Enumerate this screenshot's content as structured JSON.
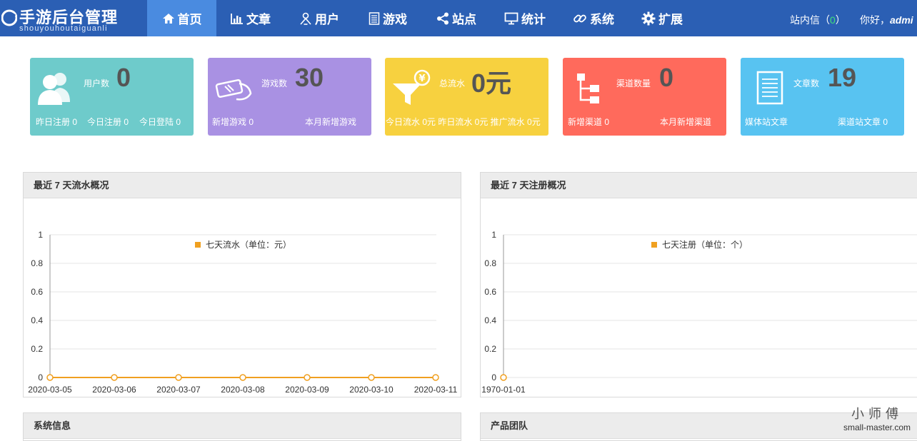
{
  "logo": {
    "title": "手游后台管理",
    "subtitle": "shouyouhoutaiguanli"
  },
  "nav": [
    {
      "label": "首页",
      "icon": "home-icon",
      "active": true
    },
    {
      "label": "文章",
      "icon": "bar-chart-icon",
      "active": false
    },
    {
      "label": "用户",
      "icon": "user-icon",
      "active": false
    },
    {
      "label": "游戏",
      "icon": "document-icon",
      "active": false
    },
    {
      "label": "站点",
      "icon": "share-nodes-icon",
      "active": false
    },
    {
      "label": "统计",
      "icon": "monitor-icon",
      "active": false
    },
    {
      "label": "系统",
      "icon": "link-icon",
      "active": false
    },
    {
      "label": "扩展",
      "icon": "gear-icon",
      "active": false
    }
  ],
  "topright": {
    "messages_label": "站内信",
    "messages_open": "（",
    "messages_count": "0",
    "messages_close": "）",
    "greeting": "你好，",
    "username": "admi"
  },
  "cards": [
    {
      "label": "用户数",
      "value": "0",
      "icon": "users-icon",
      "color": "#6ecbcb",
      "footer": [
        "昨日注册 0",
        "今日注册 0",
        "今日登陆 0"
      ]
    },
    {
      "label": "游戏数",
      "value": "30",
      "icon": "game-hand-icon",
      "color": "#a991e3",
      "footer": [
        "新增游戏 0",
        "本月新增游戏"
      ]
    },
    {
      "label": "总流水",
      "value": "0元",
      "icon": "funnel-yen-icon",
      "color": "#f7d13f",
      "footer": [
        "今日流水 0元 昨日流水 0元 推广流水 0元"
      ]
    },
    {
      "label": "渠道数量",
      "value": "0",
      "icon": "sitemap-icon",
      "color": "#ff6a5c",
      "footer": [
        "新增渠道 0",
        "本月新增渠道"
      ]
    },
    {
      "label": "文章数",
      "value": "19",
      "icon": "article-icon",
      "color": "#58c3f1",
      "footer": [
        "媒体站文章",
        "渠道站文章 0"
      ]
    }
  ],
  "panels": {
    "revenue": {
      "title": "最近 7 天流水概况"
    },
    "register": {
      "title": "最近 7 天注册概况"
    },
    "sysinfo": {
      "title": "系统信息"
    },
    "team": {
      "title": "产品团队"
    }
  },
  "chart_data": [
    {
      "type": "line",
      "legend": "七天流水（单位：元）",
      "legend_position": "top-center",
      "grid": true,
      "ylim": [
        0,
        1
      ],
      "yticks": [
        "0",
        "0.2",
        "0.4",
        "0.6",
        "0.8",
        "1"
      ],
      "categories": [
        "2020-03-05",
        "2020-03-06",
        "2020-03-07",
        "2020-03-08",
        "2020-03-09",
        "2020-03-10",
        "2020-03-11"
      ],
      "series": [
        {
          "name": "七天流水（单位：元）",
          "values": [
            0,
            0,
            0,
            0,
            0,
            0,
            0
          ],
          "color": "#f0a020"
        }
      ]
    },
    {
      "type": "line",
      "legend": "七天注册（单位：个）",
      "legend_position": "top-center",
      "grid": true,
      "ylim": [
        0,
        1
      ],
      "yticks": [
        "0",
        "0.2",
        "0.4",
        "0.6",
        "0.8",
        "1"
      ],
      "categories": [
        "1970-01-01"
      ],
      "series": [
        {
          "name": "七天注册（单位：个）",
          "values": [
            0
          ],
          "color": "#f0a020"
        }
      ]
    }
  ],
  "watermark": {
    "line1": "小师傅",
    "line2": "small-master.com"
  }
}
